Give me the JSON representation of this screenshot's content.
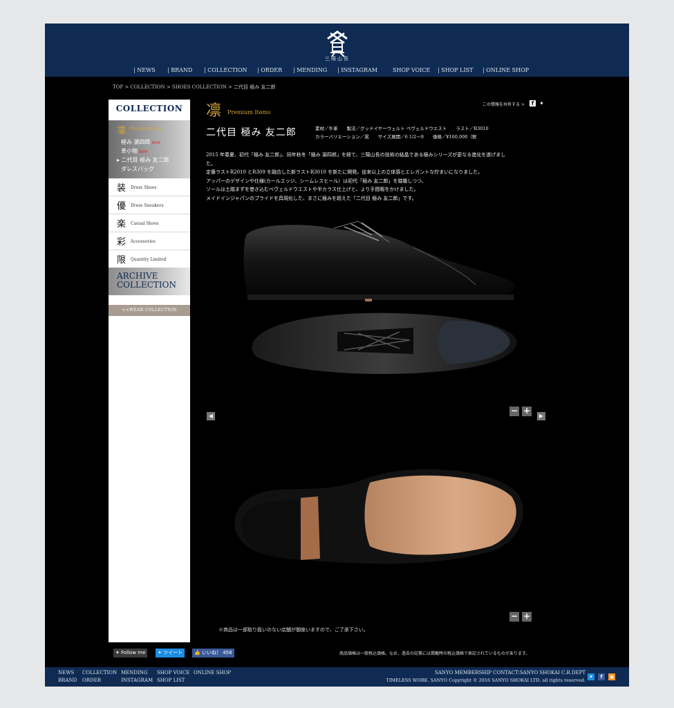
{
  "brand": {
    "logo_text": "三陽山長"
  },
  "nav": [
    "| NEWS",
    "| BRAND",
    "| COLLECTION",
    "| ORDER",
    "| MENDING",
    "| INSTAGRAM",
    "SHOP VOICE",
    "| SHOP LIST",
    "| ONLINE SHOP"
  ],
  "breadcrumb": "TOP > COLLECTION > SHOES COLLECTION > 二代目 極み 友二郎",
  "sidebar": {
    "title": "COLLECTION",
    "premium": {
      "kanji": "凛",
      "label": "Premium Items",
      "items": [
        {
          "label": "極み 源四郎",
          "badge": "new"
        },
        {
          "label": "革小物",
          "badge": "new"
        },
        {
          "label": "▸ 二代目 極み 友二郎",
          "badge": ""
        },
        {
          "label": "ダレスバッグ",
          "badge": ""
        }
      ]
    },
    "categories": [
      {
        "kanji": "装",
        "label": "Dress Shoes"
      },
      {
        "kanji": "優",
        "label": "Dress Sneakers"
      },
      {
        "kanji": "楽",
        "label": "Casual Shoes"
      },
      {
        "kanji": "彩",
        "label": "Accessories"
      },
      {
        "kanji": "限",
        "label": "Quantity Limited"
      }
    ],
    "archive": "ARCHIVE COLLECTION",
    "wear": "<<WEAR COLLECTION"
  },
  "main": {
    "section_kanji": "凛",
    "section_en": "Premium Items",
    "share_label": "この情報を共有する >",
    "product_name": "二代目 極み 友二郎",
    "specs": [
      "素材／牛革　　製法／グッドイヤーウェルト ベヴェルドウエスト　　ラスト／R3010",
      "カラーバリエーション／黒　　サイズ展開／6 1/2〜9　　価格／¥160,000（税"
    ],
    "description": [
      "2015 年春夏、初代「極み 友二郎」、同年秋冬「極み 源四郎」を経て、三陽山長の技術の結晶である極みシリーズが更なる進化を遂げまし",
      "た。",
      "定番ラストR2010 とR309 を融合した新ラストR3010 を新たに開発。従来以上の立体感とエレガントな佇まいになりました。",
      "アッパーのデザインや仕様(カールエッジ、シームレスヒール）は初代「極み 友二郎」を踏襲しつつ、",
      "ソールは土踏まずを巻き込むベヴェルドウエストや半カラス仕上げと、より手間暇をかけました。",
      "メイドインジャパンのプライドを具現化した、まさに極みを超えた「二代目 極み 友二郎」です。"
    ],
    "note": "※商品は一部取り扱いのない店舗が御座いますので、ご了承下さい。"
  },
  "social": {
    "follow": "Follow me",
    "tweet": "ツイート",
    "like": "いいね！",
    "like_count": "458"
  },
  "disclaimer": "商品価格は一般税込価格。なお、過去の記事には掲載時の税込価格で表記されているものがあります。",
  "footer": {
    "row1": [
      "NEWS",
      "COLLECTION",
      "MENDING",
      "SHOP VOICE",
      "ONLINE SHOP"
    ],
    "row2": [
      "BRAND",
      "ORDER",
      "INSTAGRAM",
      "SHOP LIST"
    ],
    "right1": "SANYO  MEMBERSHIP  CONTACT:SANYO SHOKAI C.R.DEPT",
    "right2": "TIMELESS WORK. SANYO  Copyright © 2016 SANYO SHOKAI LTD. all rights reserved."
  },
  "colors": {
    "navy": "#0f2b53",
    "gold": "#d5a73a",
    "new_red": "#e2231a"
  }
}
